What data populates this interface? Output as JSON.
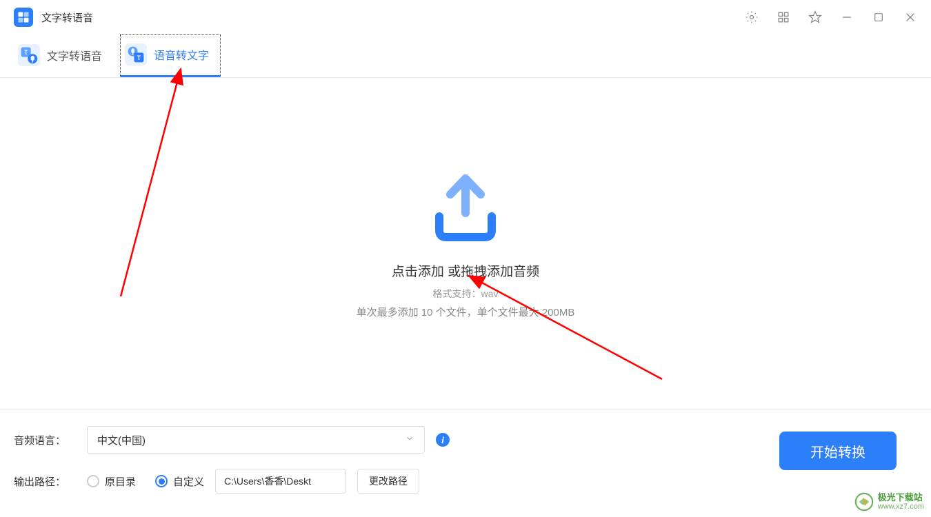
{
  "titlebar": {
    "app_title": "文字转语音"
  },
  "tabs": {
    "tts_label": "文字转语音",
    "stt_label": "语音转文字"
  },
  "dropzone": {
    "main_text": "点击添加 或拖拽添加音频",
    "format_text": "格式支持：wav",
    "limit_text": "单次最多添加 10 个文件，单个文件最大 200MB"
  },
  "settings": {
    "language_label": "音频语言：",
    "language_value": "中文(中国)",
    "output_label": "输出路径：",
    "radio_original": "原目录",
    "radio_custom": "自定义",
    "path_value": "C:\\Users\\香香\\Deskt",
    "change_path_label": "更改路径"
  },
  "actions": {
    "convert_label": "开始转换"
  },
  "watermark": {
    "site_name": "极光下载站",
    "site_url": "www.xz7.com"
  }
}
